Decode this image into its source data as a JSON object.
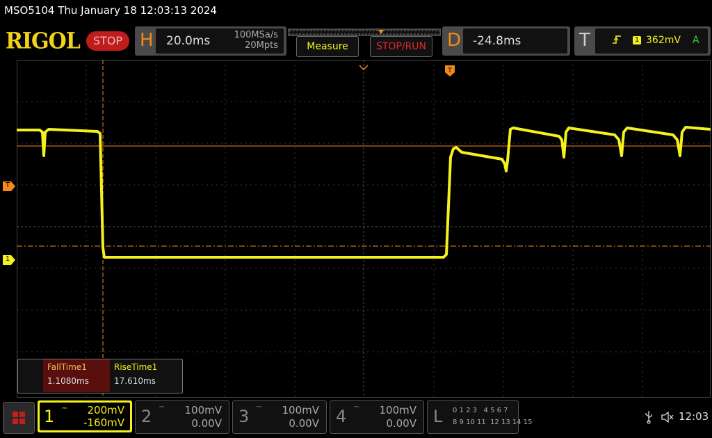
{
  "title": "MSO5104  Thu January 18 12:03:13 2024",
  "logo": "RIGOL",
  "run_state": "STOP",
  "horizontal": {
    "letter": "H",
    "timebase": "20.0ms",
    "sample_rate": "100MSa/s",
    "memory_depth": "20Mpts"
  },
  "buttons": {
    "measure": "Measure",
    "stop_run": "STOP/RUN"
  },
  "delay": {
    "letter": "D",
    "value": "-24.8ms"
  },
  "trigger": {
    "letter": "T",
    "source": "1",
    "level": "362mV",
    "mode": "A"
  },
  "side_markers": {
    "trigger": "T",
    "channel1": "1"
  },
  "measurements": [
    {
      "label": "FallTime1",
      "value": "1.1080ms"
    },
    {
      "label": "RiseTime1",
      "value": "17.610ms"
    }
  ],
  "channels": [
    {
      "num": "1",
      "scale": "200mV",
      "offset": "-160mV",
      "active": true
    },
    {
      "num": "2",
      "scale": "100mV",
      "offset": "0.00V",
      "active": false
    },
    {
      "num": "3",
      "scale": "100mV",
      "offset": "0.00V",
      "active": false
    },
    {
      "num": "4",
      "scale": "100mV",
      "offset": "0.00V",
      "active": false
    }
  ],
  "logic": {
    "letter": "L",
    "row1": "0 1 2 3   4 5 6 7",
    "row2": "8 9 10 11  12 13 14 15"
  },
  "status": {
    "time": "12:03"
  },
  "colors": {
    "ch1": "#f5f01e",
    "trigger": "#f28a1a",
    "grid": "#3a3a3a"
  }
}
